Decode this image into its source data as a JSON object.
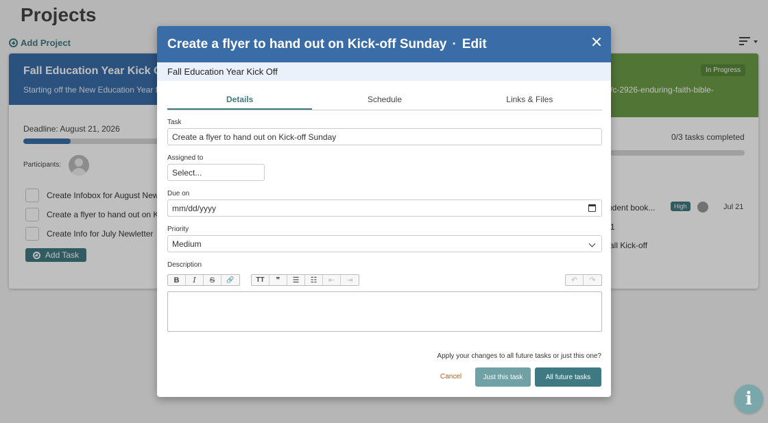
{
  "page": {
    "title": "Projects",
    "add_project_label": "Add Project"
  },
  "project": {
    "title": "Fall Education Year Kick Off",
    "description_visible": "Starting off the New Education Year f",
    "link_visible": "/c-2926-enduring-faith-bible-",
    "status": "In Progress",
    "deadline": "Deadline: August 21, 2026",
    "progress_fraction": 0.33,
    "tasks_completed": "0/3 tasks completed",
    "participants_label": "Participants:",
    "tasks": [
      {
        "label": "Create Infobox for August New"
      },
      {
        "label": "Create a flyer to hand out on K"
      },
      {
        "label": "Create Info for July Newletter"
      }
    ],
    "add_task_label": "Add Task",
    "right_tasks": [
      {
        "label": "udent book..."
      },
      {
        "label": "1"
      },
      {
        "label": "all Kick-off"
      }
    ],
    "priority_badge": "High",
    "task_date": "Jul 21"
  },
  "modal": {
    "title": "Create a flyer to hand out on Kick-off Sunday",
    "separator": "·",
    "mode": "Edit",
    "subheader": "Fall Education Year Kick Off",
    "tabs": [
      {
        "label": "Details",
        "active": true
      },
      {
        "label": "Schedule",
        "active": false
      },
      {
        "label": "Links & Files",
        "active": false
      }
    ],
    "fields": {
      "task_label": "Task",
      "task_value": "Create a flyer to hand out on Kick-off Sunday",
      "assigned_label": "Assigned to",
      "assigned_value": "Select...",
      "due_label": "Due on",
      "due_placeholder": "mm/dd/yyyy",
      "priority_label": "Priority",
      "priority_value": "Medium",
      "description_label": "Description"
    },
    "toolbar": {
      "bold": "B",
      "italic": "I",
      "strike": "S",
      "link": "🔗",
      "heading": "TT",
      "quote": "❞",
      "bullet_list": "☰",
      "numbered_list": "☷",
      "outdent": "⇤",
      "indent": "⇥",
      "undo": "↶",
      "redo": "↷"
    },
    "apply_question": "Apply your changes to all future tasks or just this one?",
    "cancel_label": "Cancel",
    "just_this_label": "Just this task",
    "all_future_label": "All future tasks"
  },
  "colors": {
    "header_blue": "#3a6da8",
    "teal": "#3f7a82",
    "status_green": "#6b9c47",
    "cancel_orange": "#b35a16"
  },
  "icons": [
    "plus-circle-icon",
    "sort-icon",
    "close-icon",
    "calendar-icon",
    "chevron-down-icon",
    "info-icon",
    "avatar"
  ]
}
